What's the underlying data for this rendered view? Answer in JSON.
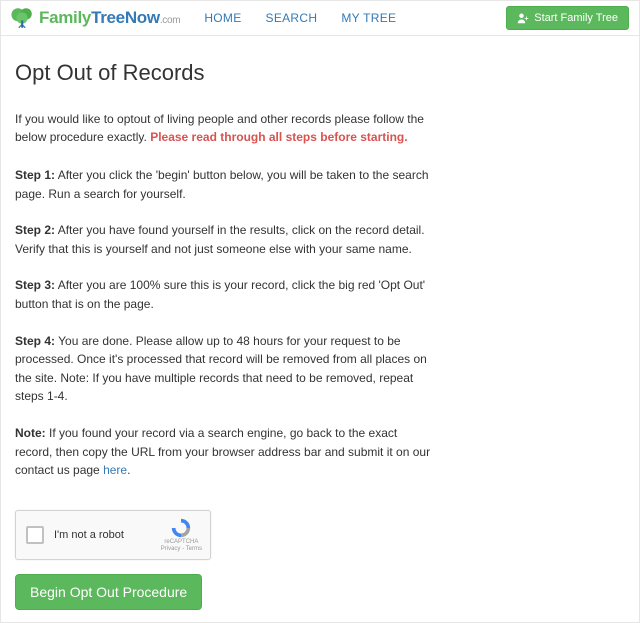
{
  "header": {
    "logo": {
      "family": "Family",
      "treenow": "TreeNow",
      "dotcom": ".com"
    },
    "nav": {
      "home": "HOME",
      "search": "SEARCH",
      "mytree": "MY TREE"
    },
    "start_button": "Start Family Tree"
  },
  "page": {
    "title": "Opt Out of Records",
    "intro_text": "If you would like to optout of living people and other records please follow the below procedure exactly. ",
    "intro_warning": "Please read through all steps before starting.",
    "steps": {
      "s1_label": "Step 1:",
      "s1_text": " After you click the 'begin' button below, you will be taken to the search page. Run a search for yourself.",
      "s2_label": "Step 2:",
      "s2_text": " After you have found yourself in the results, click on the record detail. Verify that this is yourself and not just someone else with your same name.",
      "s3_label": "Step 3:",
      "s3_text": " After you are 100% sure this is your record, click the big red 'Opt Out' button that is on the page.",
      "s4_label": "Step 4:",
      "s4_text": " You are done. Please allow up to 48 hours for your request to be processed. Once it's processed that record will be removed from all places on the site. Note: If you have multiple records that need to be removed, repeat steps 1-4.",
      "note_label": "Note:",
      "note_text": " If you found your record via a search engine, go back to the exact record, then copy the URL from your browser address bar and submit it on our contact us page ",
      "note_link": "here",
      "note_after": "."
    },
    "recaptcha": {
      "label": "I'm not a robot",
      "brand": "reCAPTCHA",
      "terms": "Privacy - Terms"
    },
    "begin_button": "Begin Opt Out Procedure"
  }
}
